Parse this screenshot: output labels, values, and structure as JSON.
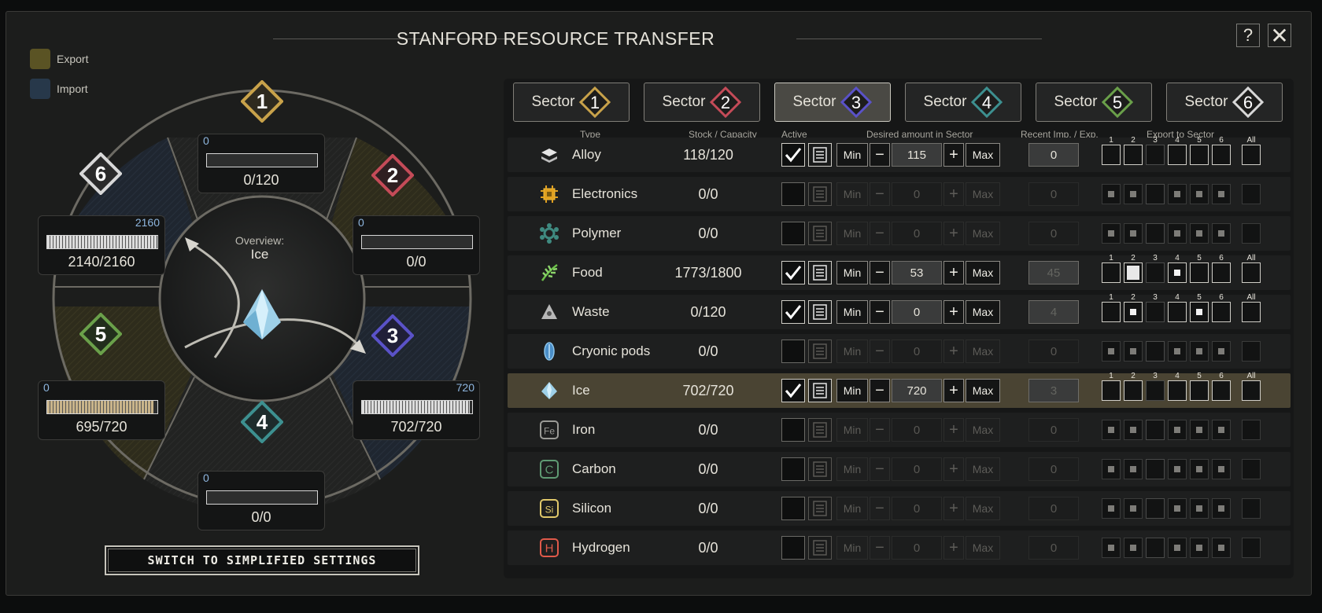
{
  "window": {
    "title": "STANFORD RESOURCE TRANSFER",
    "help_label": "?",
    "close_label": "✕"
  },
  "legend": [
    {
      "label": "Export",
      "color": "#5a5324"
    },
    {
      "label": "Import",
      "color": "#27384a"
    }
  ],
  "overview": {
    "label": "Overview:",
    "resource": "Ice"
  },
  "wheel_sectors": [
    {
      "id": "1",
      "min": "0",
      "max": "",
      "amount": "0/120",
      "fill": 0.0,
      "fill_color": "#2d2e2e",
      "badge_color": "#c8a24a"
    },
    {
      "id": "2",
      "min": "0",
      "max": "",
      "amount": "0/0",
      "fill": 0.0,
      "fill_color": "#2d2e2e",
      "badge_color": "#c44b58"
    },
    {
      "id": "3",
      "min": "",
      "max": "720",
      "amount": "702/720",
      "fill": 0.975,
      "fill_color": "#dcdcdc",
      "badge_color": "#5a52c8"
    },
    {
      "id": "4",
      "min": "0",
      "max": "",
      "amount": "0/0",
      "fill": 0.0,
      "fill_color": "#2d2e2e",
      "badge_color": "#3d9090"
    },
    {
      "id": "5",
      "min": "0",
      "max": "",
      "amount": "695/720",
      "fill": 0.965,
      "fill_color": "#c9b48a",
      "badge_color": "#6aa04a"
    },
    {
      "id": "6",
      "min": "",
      "max": "2160",
      "amount": "2140/2160",
      "fill": 0.99,
      "fill_color": "#dcdcdc",
      "badge_color": "#d8d8d8"
    }
  ],
  "simplify_label": "SWITCH TO SIMPLIFIED SETTINGS",
  "tabs": [
    {
      "label": "Sector",
      "num": "1",
      "color": "#c8a24a",
      "active": false
    },
    {
      "label": "Sector",
      "num": "2",
      "color": "#c44b58",
      "active": false
    },
    {
      "label": "Sector",
      "num": "3",
      "color": "#5a52c8",
      "active": true
    },
    {
      "label": "Sector",
      "num": "4",
      "color": "#3d9090",
      "active": false
    },
    {
      "label": "Sector",
      "num": "5",
      "color": "#6aa04a",
      "active": false
    },
    {
      "label": "Sector",
      "num": "6",
      "color": "#d8d8d8",
      "active": false
    }
  ],
  "columns": {
    "type": "Type",
    "stock": "Stock / Capacity",
    "active": "Active",
    "desired": "Desired amount in Sector",
    "recent": "Recent Imp. / Exp.",
    "export": "Export to Sector"
  },
  "buttons": {
    "min": "Min",
    "minus": "−",
    "plus": "+",
    "max": "Max"
  },
  "export_labels": [
    "1",
    "2",
    "3",
    "4",
    "5",
    "6",
    "All"
  ],
  "resources": [
    {
      "name": "Alloy",
      "icon": "alloy-icon",
      "stock": "118/120",
      "active": true,
      "desired": "115",
      "recent": "0",
      "recent_faint": false,
      "export": [
        "off",
        "off",
        "self",
        "off",
        "off",
        "off",
        "off"
      ]
    },
    {
      "name": "Electronics",
      "icon": "electronics-icon",
      "stock": "0/0",
      "active": false,
      "desired": "0",
      "recent": "0",
      "export": [
        "dot",
        "dot",
        "self",
        "dot",
        "dot",
        "dot",
        "none"
      ]
    },
    {
      "name": "Polymer",
      "icon": "polymer-icon",
      "stock": "0/0",
      "active": false,
      "desired": "0",
      "recent": "0",
      "export": [
        "dot",
        "dot",
        "self",
        "dot",
        "dot",
        "dot",
        "none"
      ]
    },
    {
      "name": "Food",
      "icon": "food-icon",
      "stock": "1773/1800",
      "active": true,
      "desired": "53",
      "recent": "45",
      "recent_faint": true,
      "export": [
        "off",
        "big",
        "self",
        "on",
        "off",
        "off",
        "off"
      ]
    },
    {
      "name": "Waste",
      "icon": "waste-icon",
      "stock": "0/120",
      "active": true,
      "desired": "0",
      "recent": "4",
      "recent_faint": true,
      "export": [
        "off",
        "on",
        "self",
        "off",
        "on",
        "off",
        "off"
      ]
    },
    {
      "name": "Cryonic pods",
      "icon": "cryonic-pod-icon",
      "stock": "0/0",
      "active": false,
      "desired": "0",
      "recent": "0",
      "export": [
        "dot",
        "dot",
        "self",
        "dot",
        "dot",
        "dot",
        "none"
      ]
    },
    {
      "name": "Ice",
      "icon": "ice-icon",
      "stock": "702/720",
      "active": true,
      "desired": "720",
      "recent": "3",
      "recent_faint": true,
      "highlight": true,
      "export": [
        "off",
        "off",
        "self",
        "off",
        "off",
        "off",
        "off"
      ]
    },
    {
      "name": "Iron",
      "icon": "iron-icon",
      "symbol": "Fe",
      "symbol_color": "#9a9a96",
      "stock": "0/0",
      "active": false,
      "desired": "0",
      "recent": "0",
      "export": [
        "dot",
        "dot",
        "self",
        "dot",
        "dot",
        "dot",
        "none"
      ]
    },
    {
      "name": "Carbon",
      "icon": "carbon-icon",
      "symbol": "C",
      "symbol_color": "#5f9a73",
      "stock": "0/0",
      "active": false,
      "desired": "0",
      "recent": "0",
      "export": [
        "dot",
        "dot",
        "self",
        "dot",
        "dot",
        "dot",
        "none"
      ]
    },
    {
      "name": "Silicon",
      "icon": "silicon-icon",
      "symbol": "Si",
      "symbol_color": "#e0c86a",
      "stock": "0/0",
      "active": false,
      "desired": "0",
      "recent": "0",
      "export": [
        "dot",
        "dot",
        "self",
        "dot",
        "dot",
        "dot",
        "none"
      ]
    },
    {
      "name": "Hydrogen",
      "icon": "hydrogen-icon",
      "symbol": "H",
      "symbol_color": "#e05a4a",
      "stock": "0/0",
      "active": false,
      "desired": "0",
      "recent": "0",
      "export": [
        "dot",
        "dot",
        "self",
        "dot",
        "dot",
        "dot",
        "none"
      ]
    }
  ]
}
